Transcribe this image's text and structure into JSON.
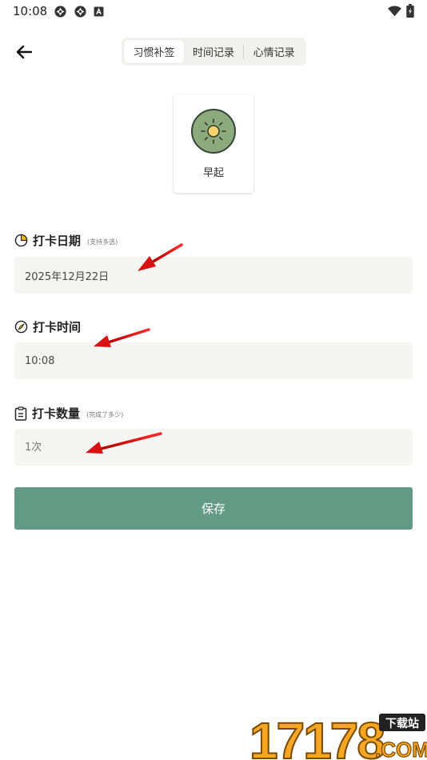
{
  "status_bar": {
    "time": "10:08",
    "left_icons": [
      "sync-icon",
      "sync-icon",
      "notification-a-icon"
    ],
    "right_icons": [
      "wifi-icon",
      "battery-icon"
    ]
  },
  "nav": {
    "back_icon": "arrow-left-icon",
    "tabs": [
      {
        "label": "习惯补签",
        "active": true
      },
      {
        "label": "时间记录",
        "active": false
      },
      {
        "label": "心情记录",
        "active": false
      }
    ]
  },
  "habit": {
    "name": "早起",
    "icon": "sun-icon"
  },
  "form": {
    "date": {
      "icon": "pie-clock-icon",
      "label": "打卡日期",
      "hint": "(支持多选)",
      "value": "2025年12月22日"
    },
    "time": {
      "icon": "compass-icon",
      "label": "打卡时间",
      "value": "10:08"
    },
    "count": {
      "icon": "clipboard-icon",
      "label": "打卡数量",
      "hint": "(完成了多少)",
      "placeholder": "1次"
    },
    "save_label": "保存"
  },
  "watermark": {
    "number": "17178",
    "badge": "下载站",
    "domain": ".COM"
  },
  "colors": {
    "accent": "#629a86",
    "field_bg": "#f5f5f2",
    "tab_bg": "#f1f1ef",
    "habit_icon_bg": "#8daa7c",
    "annotation_arrow": "#e01010",
    "watermark_orange": "#f5a623"
  }
}
